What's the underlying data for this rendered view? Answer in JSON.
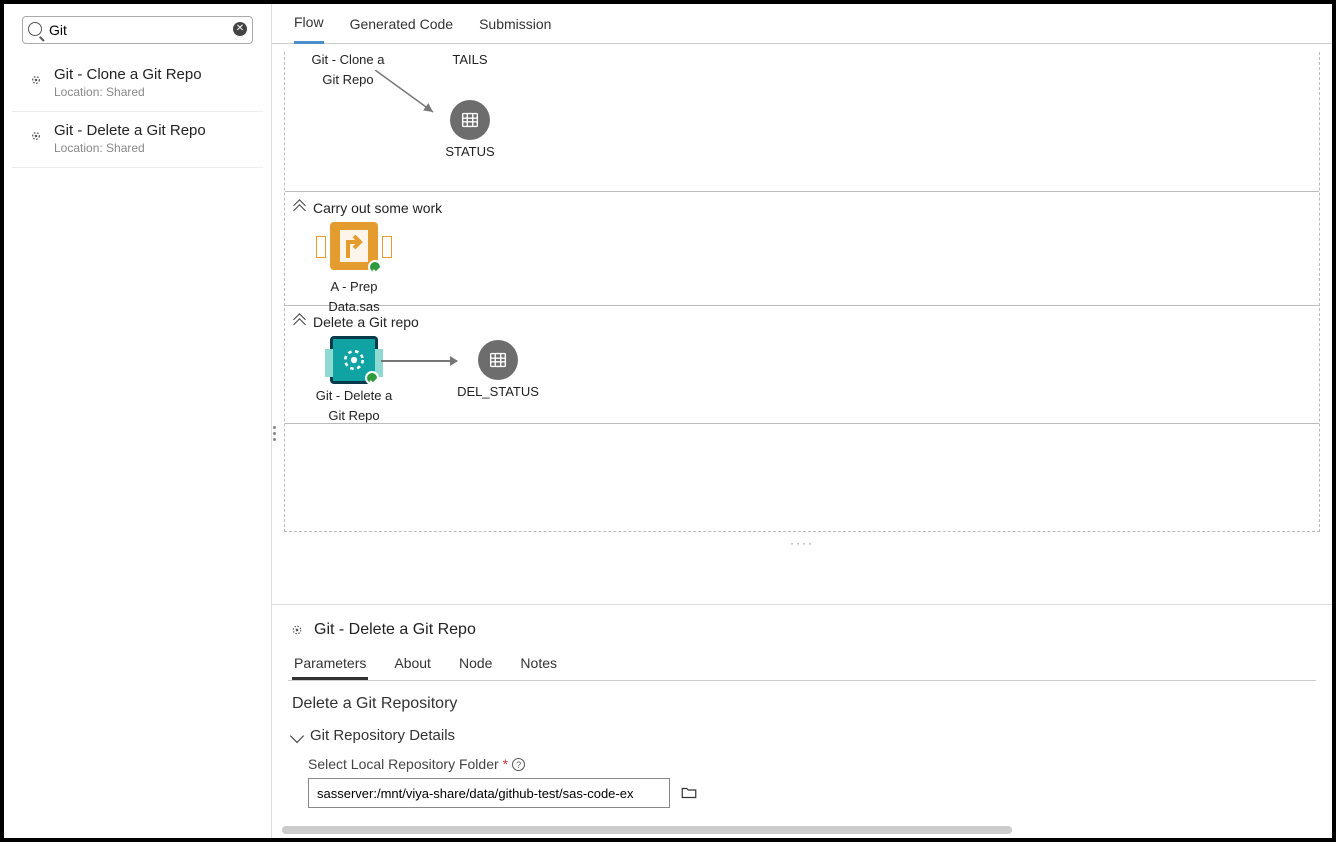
{
  "search": {
    "value": "Git"
  },
  "sidebar": {
    "items": [
      {
        "title": "Git - Clone a Git Repo",
        "sub": "Location: Shared"
      },
      {
        "title": "Git - Delete a Git Repo",
        "sub": "Location: Shared"
      }
    ]
  },
  "topTabs": [
    "Flow",
    "Generated Code",
    "Submission"
  ],
  "activeTopTab": "Flow",
  "flow": {
    "partial": {
      "leftNodeTop": "Git - Clone a",
      "leftNodeBottom": "Git Repo",
      "rightTopLabel": "TAILS",
      "statusLabel": "STATUS"
    },
    "section2": {
      "title": "Carry out some work",
      "nodeLine1": "A - Prep",
      "nodeLine2": "Data.sas"
    },
    "section3": {
      "title": "Delete a Git repo",
      "nodeLine1": "Git - Delete a",
      "nodeLine2": "Git Repo",
      "outLabel": "DEL_STATUS"
    }
  },
  "props": {
    "title": "Git - Delete a Git Repo",
    "tabs": [
      "Parameters",
      "About",
      "Node",
      "Notes"
    ],
    "activeTab": "Parameters",
    "heading": "Delete a Git Repository",
    "group": "Git Repository Details",
    "fieldLabel": "Select Local Repository Folder",
    "fieldValue": "sasserver:/mnt/viya-share/data/github-test/sas-code-ex"
  }
}
